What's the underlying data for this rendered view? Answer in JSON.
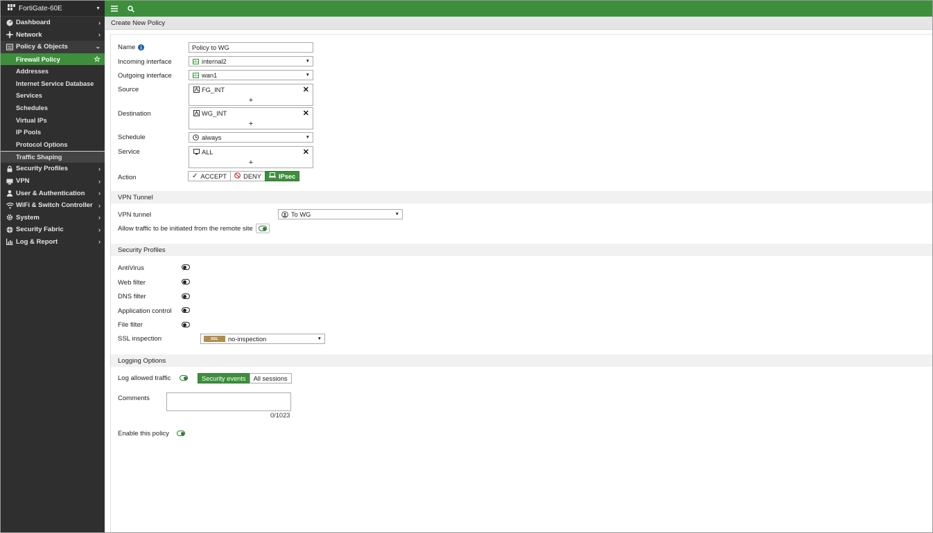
{
  "device": {
    "name": "FortiGate-60E"
  },
  "nav": [
    {
      "label": "Dashboard",
      "icon": "dashboard-icon"
    },
    {
      "label": "Network",
      "icon": "network-icon"
    },
    {
      "label": "Policy & Objects",
      "icon": "policy-icon",
      "open": true
    },
    {
      "label": "Security Profiles",
      "icon": "lock-icon"
    },
    {
      "label": "VPN",
      "icon": "vpn-icon"
    },
    {
      "label": "User & Authentication",
      "icon": "user-icon"
    },
    {
      "label": "WiFi & Switch Controller",
      "icon": "wifi-icon"
    },
    {
      "label": "System",
      "icon": "gear-icon"
    },
    {
      "label": "Security Fabric",
      "icon": "fabric-icon"
    },
    {
      "label": "Log & Report",
      "icon": "chart-icon"
    }
  ],
  "subnav": [
    {
      "label": "Firewall Policy",
      "active": true
    },
    {
      "label": "Addresses"
    },
    {
      "label": "Internet Service Database"
    },
    {
      "label": "Services"
    },
    {
      "label": "Schedules"
    },
    {
      "label": "Virtual IPs"
    },
    {
      "label": "IP Pools"
    },
    {
      "label": "Protocol Options"
    },
    {
      "label": "Traffic Shaping"
    }
  ],
  "page": {
    "title": "Create New Policy"
  },
  "form": {
    "name_label": "Name",
    "name_value": "Policy to WG",
    "incoming_label": "Incoming interface",
    "incoming_value": "internal2",
    "outgoing_label": "Outgoing interface",
    "outgoing_value": "wan1",
    "source_label": "Source",
    "source_value": "FG_INT",
    "destination_label": "Destination",
    "destination_value": "WG_INT",
    "schedule_label": "Schedule",
    "schedule_value": "always",
    "service_label": "Service",
    "service_value": "ALL",
    "add_symbol": "+",
    "remove_symbol": "✕",
    "action_label": "Action",
    "action_accept": "ACCEPT",
    "action_deny": "DENY",
    "action_ipsec": "IPsec"
  },
  "vpn": {
    "section": "VPN Tunnel",
    "tunnel_label": "VPN tunnel",
    "tunnel_value": "To WG",
    "allow_label": "Allow traffic to be initiated from the remote site"
  },
  "security": {
    "section": "Security Profiles",
    "antivirus": "AntiVirus",
    "webfilter": "Web filter",
    "dnsfilter": "DNS filter",
    "appcontrol": "Application control",
    "filefilter": "File filter",
    "ssl_label": "SSL inspection",
    "ssl_badge": "SSL",
    "ssl_value": "no-inspection"
  },
  "logging": {
    "section": "Logging Options",
    "log_label": "Log allowed traffic",
    "opt_security": "Security events",
    "opt_all": "All sessions",
    "comments_label": "Comments",
    "counter": "0/1023",
    "enable_label": "Enable this policy"
  },
  "colors": {
    "accent": "#3d8f3c",
    "sidebar": "#2f2f2f"
  }
}
